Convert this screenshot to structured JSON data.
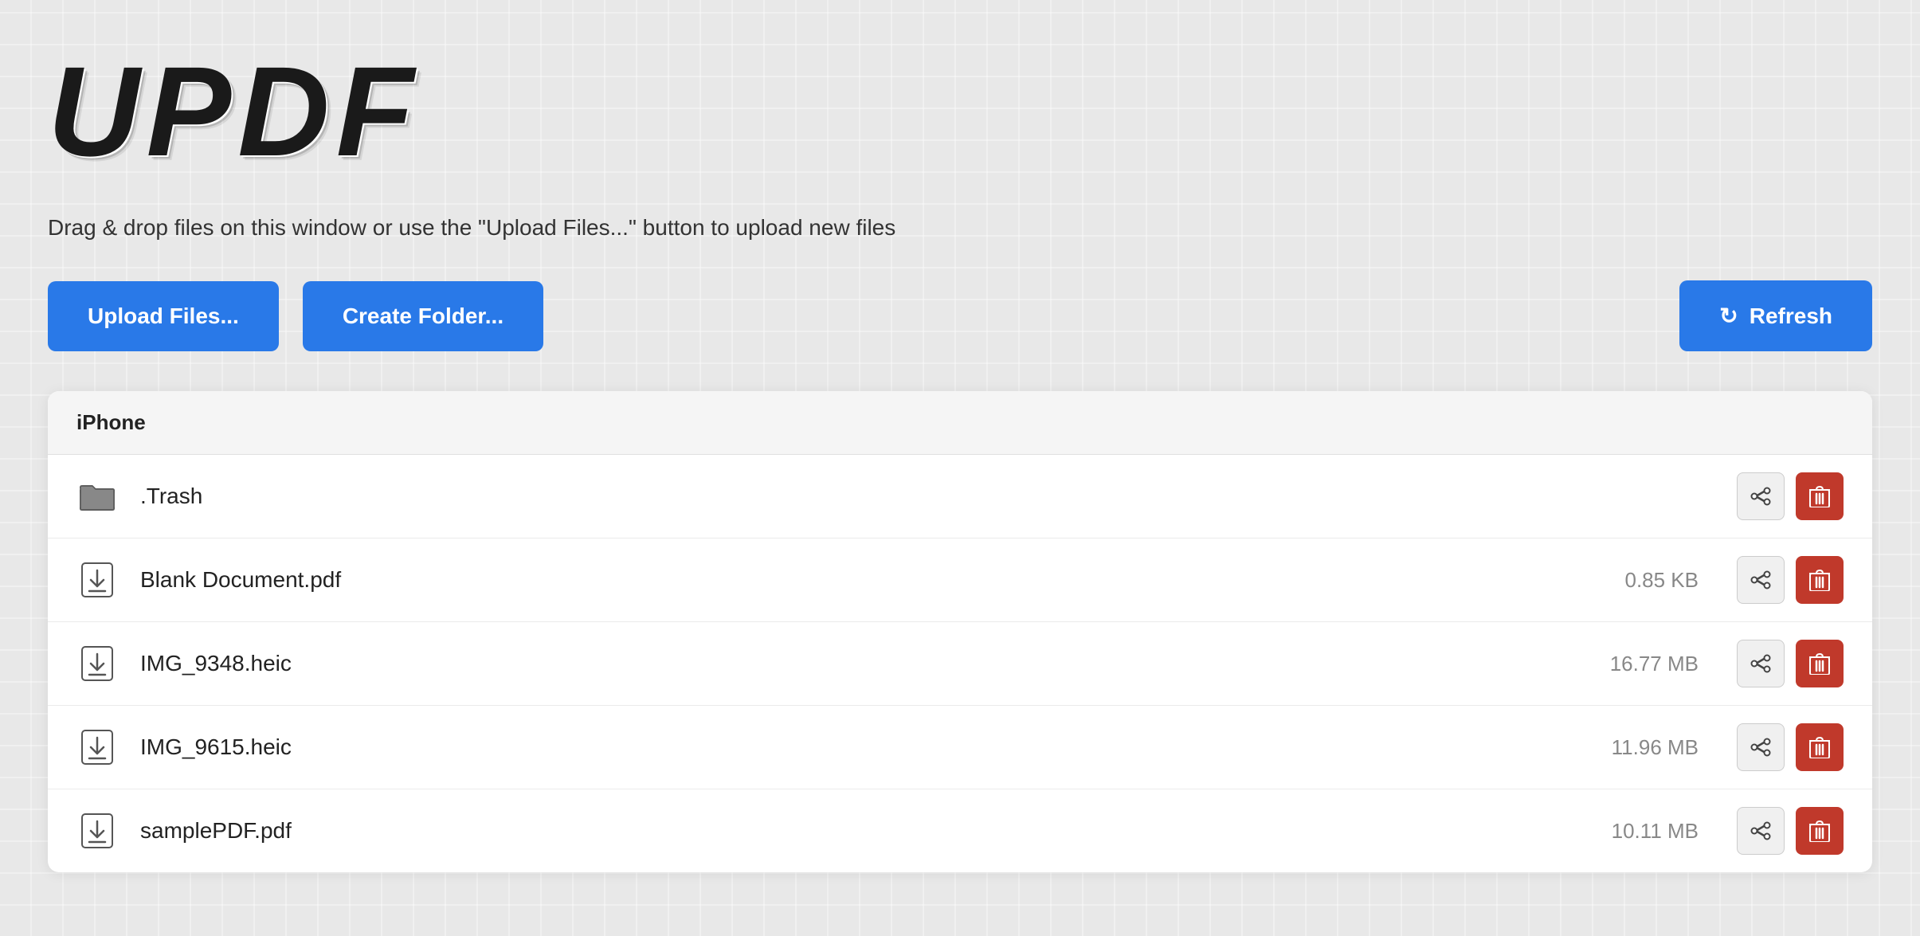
{
  "logo": {
    "text": "UPDF"
  },
  "subtitle": {
    "text": "Drag & drop files on this window or use the \"Upload Files...\" button to upload new files"
  },
  "buttons": {
    "upload_label": "Upload Files...",
    "create_folder_label": "Create Folder...",
    "refresh_label": "Refresh"
  },
  "panel": {
    "header": "iPhone",
    "files": [
      {
        "id": "trash",
        "name": ".Trash",
        "size": "",
        "type": "folder"
      },
      {
        "id": "blank-pdf",
        "name": "Blank Document.pdf",
        "size": "0.85 KB",
        "type": "file"
      },
      {
        "id": "img-9348",
        "name": "IMG_9348.heic",
        "size": "16.77 MB",
        "type": "file"
      },
      {
        "id": "img-9615",
        "name": "IMG_9615.heic",
        "size": "11.96 MB",
        "type": "file"
      },
      {
        "id": "sample-pdf",
        "name": "samplePDF.pdf",
        "size": "10.11 MB",
        "type": "file"
      }
    ]
  },
  "colors": {
    "blue": "#2979e8",
    "red": "#c0392b",
    "background": "#e8e8e8"
  }
}
